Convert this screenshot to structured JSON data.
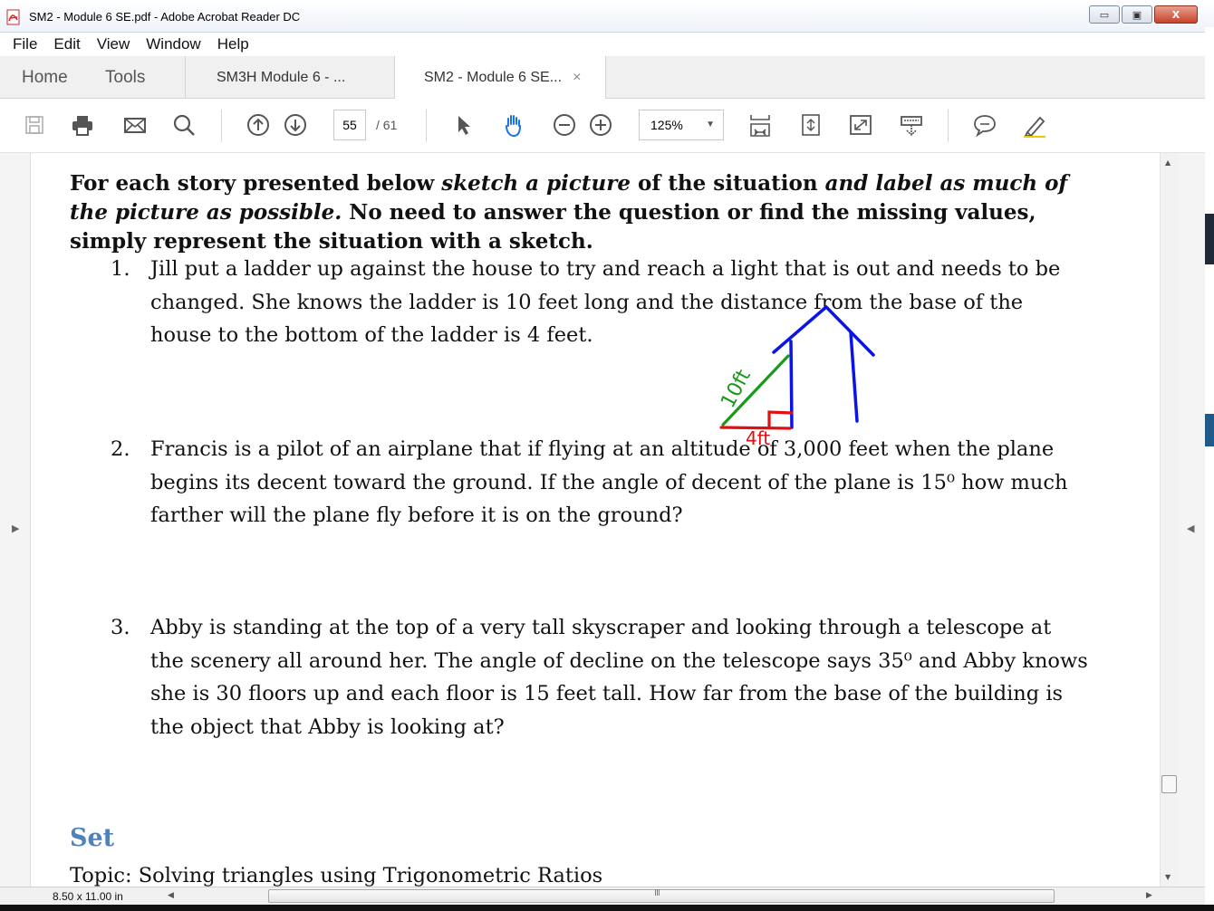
{
  "window": {
    "title": "SM2 - Module 6 SE.pdf - Adobe Acrobat Reader DC",
    "minimize_glyph": "▭",
    "maximize_glyph": "▣",
    "close_glyph": "X"
  },
  "menu": [
    "File",
    "Edit",
    "View",
    "Window",
    "Help"
  ],
  "tabs": {
    "home": "Home",
    "tools": "Tools",
    "doc1": "SM3H Module 6 - ...",
    "doc2": "SM2 - Module 6 SE...",
    "close": "×"
  },
  "toolbar": {
    "page_current": "55",
    "page_total": "/ 61",
    "zoom": "125%",
    "icons": [
      "save-icon",
      "print-icon",
      "email-icon",
      "search-icon",
      "page-up-icon",
      "page-down-icon",
      "select-arrow-icon",
      "hand-tool-icon",
      "zoom-out-icon",
      "zoom-in-icon",
      "fit-page-icon",
      "fit-width-icon",
      "full-screen-icon",
      "read-mode-icon",
      "comment-icon",
      "highlight-pen-icon"
    ]
  },
  "document": {
    "intro": {
      "part1": "For each story presented below ",
      "part2": "sketch a picture",
      "part3": " of the situation ",
      "part4": "and label as much of the picture as possible.",
      "part5": " No need to answer the question or find the missing values, simply represent the situation with a sketch."
    },
    "questions": [
      {
        "num": "1.",
        "text": "Jill put a ladder up against the house to try and reach a light that is  out and needs to be changed. She knows the ladder is 10 feet long and the distance from the base of the house to the bottom of the ladder is 4 feet."
      },
      {
        "num": "2.",
        "text": "Francis is a pilot of an airplane that if flying at an altitude of 3,000 feet when the plane begins its decent toward the ground. If the angle of decent of the plane is 15⁰ how much farther will the plane fly before it is on the ground?"
      },
      {
        "num": "3.",
        "text": "Abby is standing at the top of a very tall skyscraper and looking through a telescope at the scenery all around her. The angle of decline on the telescope says 35⁰ and Abby knows she is 30 floors up and each floor is 15 feet tall. How far from the base of the building is the object that Abby is looking at?"
      }
    ],
    "set_heading": "Set",
    "topic": "Topic: Solving triangles using Trigonometric Ratios",
    "annotations": {
      "ladder_label": "10ft",
      "base_label": "4ft",
      "colors": {
        "house": "#0a14e6",
        "ladder": "#1a9a1a",
        "base": "#e01010"
      }
    }
  },
  "status": {
    "page_size": "8.50 x 11.00 in",
    "scroll_grip": "III",
    "left_arrow": "◀",
    "right_arrow": "▶",
    "up_arrow": "▲",
    "down_arrow": "▼"
  }
}
